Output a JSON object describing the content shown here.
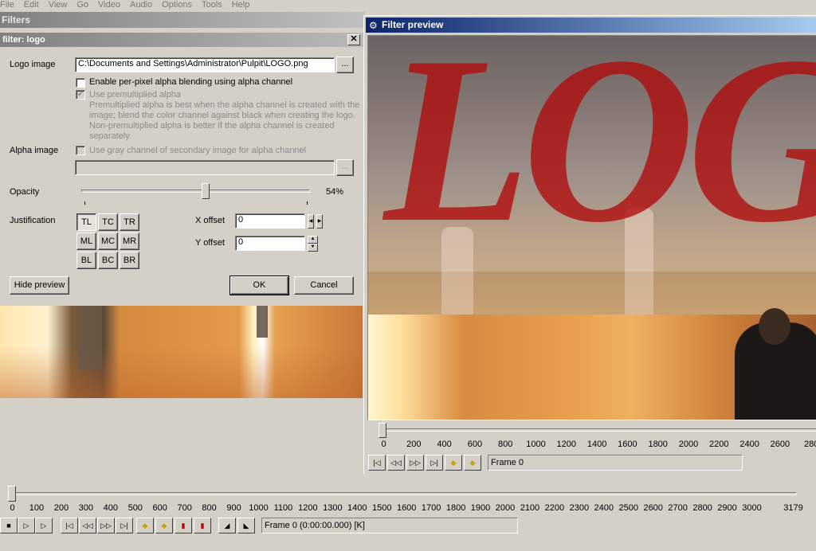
{
  "menu": [
    "File",
    "Edit",
    "View",
    "Go",
    "Video",
    "Audio",
    "Options",
    "Tools",
    "Help"
  ],
  "filters_window": {
    "title": "Filters"
  },
  "logo_dialog": {
    "title": "filter: logo",
    "logo_image_label": "Logo image",
    "logo_image_path": "C:\\Documents and Settings\\Administrator\\Pulpit\\LOGO.png",
    "browse_label": "...",
    "per_pixel_alpha_label": "Enable per-pixel alpha blending using alpha channel",
    "premultiplied_label": "Use premultiplied alpha",
    "premultiplied_desc_1": "Premultiplied alpha is best when the alpha channel is created with the",
    "premultiplied_desc_2": "image; blend the color channel against black when creating the logo.",
    "premultiplied_desc_3": "Non-premultiplied alpha is better if the alpha channel is created",
    "premultiplied_desc_4": "separately.",
    "alpha_image_label": "Alpha image",
    "gray_channel_label": "Use gray channel of secondary image for alpha channel",
    "alpha_image_path": "",
    "opacity_label": "Opacity",
    "opacity_value": "54%",
    "opacity_fraction": 0.54,
    "justification_label": "Justification",
    "justification": [
      "TL",
      "TC",
      "TR",
      "ML",
      "MC",
      "MR",
      "BL",
      "BC",
      "BR"
    ],
    "x_offset_label": "X offset",
    "x_offset_value": "0",
    "y_offset_label": "Y offset",
    "y_offset_value": "0",
    "hide_preview_label": "Hide preview",
    "ok_label": "OK",
    "cancel_label": "Cancel"
  },
  "preview_window": {
    "title": "Filter preview",
    "logo_text": "LOG",
    "scale": [
      "0",
      "200",
      "400",
      "600",
      "800",
      "1000",
      "1200",
      "1400",
      "1600",
      "1800",
      "2000",
      "2200",
      "2400",
      "2600",
      "280"
    ],
    "frame_status": "Frame 0"
  },
  "main_timeline": {
    "scale": [
      "0",
      "100",
      "200",
      "300",
      "400",
      "500",
      "600",
      "700",
      "800",
      "900",
      "1000",
      "1100",
      "1200",
      "1300",
      "1400",
      "1500",
      "1600",
      "1700",
      "1800",
      "1900",
      "2000",
      "2100",
      "2200",
      "2300",
      "2400",
      "2500",
      "2600",
      "2700",
      "2800",
      "2900",
      "3000",
      "3179"
    ],
    "frame_status": "Frame 0 (0:00:00.000) [K]"
  },
  "colors": {
    "preview_title_bg": "#0a246a",
    "logo_red": "#af0a0a"
  }
}
